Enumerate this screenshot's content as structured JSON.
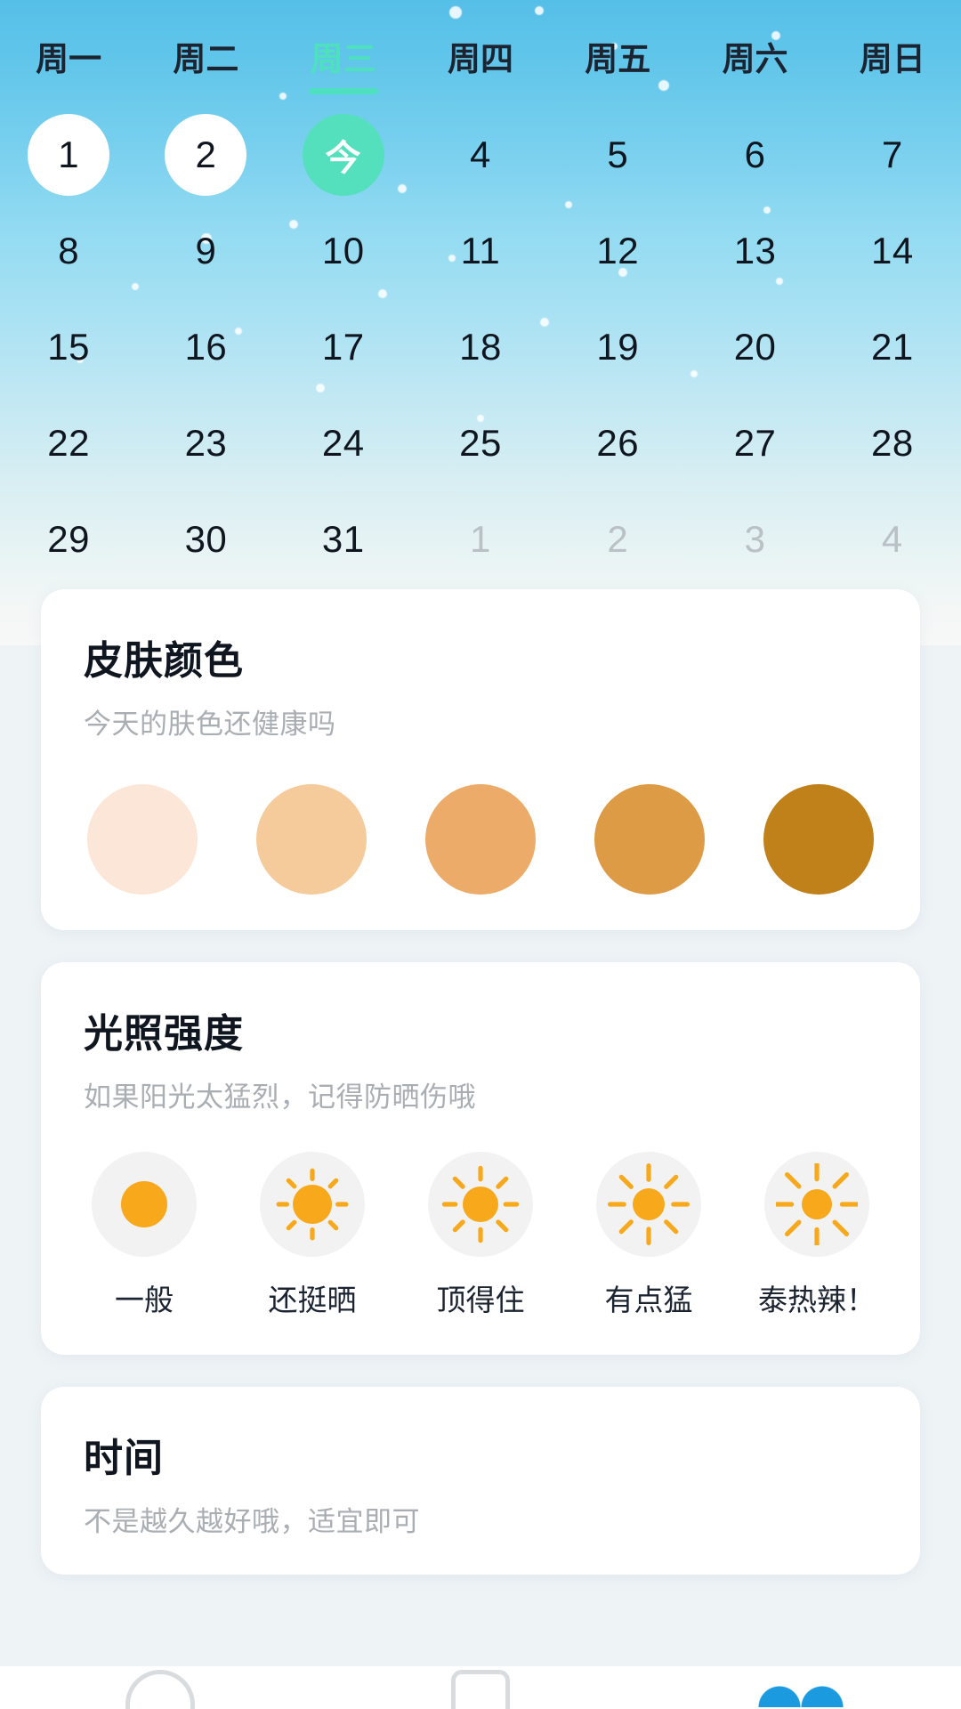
{
  "calendar": {
    "weekdays": [
      {
        "label": "周一",
        "active": false
      },
      {
        "label": "周二",
        "active": false
      },
      {
        "label": "周三",
        "active": true
      },
      {
        "label": "周四",
        "active": false
      },
      {
        "label": "周五",
        "active": false
      },
      {
        "label": "周六",
        "active": false
      },
      {
        "label": "周日",
        "active": false
      }
    ],
    "days": [
      {
        "label": "1",
        "state": "marked"
      },
      {
        "label": "2",
        "state": "marked"
      },
      {
        "label": "今",
        "state": "today"
      },
      {
        "label": "4",
        "state": "normal"
      },
      {
        "label": "5",
        "state": "normal"
      },
      {
        "label": "6",
        "state": "normal"
      },
      {
        "label": "7",
        "state": "normal"
      },
      {
        "label": "8",
        "state": "normal"
      },
      {
        "label": "9",
        "state": "normal"
      },
      {
        "label": "10",
        "state": "normal"
      },
      {
        "label": "11",
        "state": "normal"
      },
      {
        "label": "12",
        "state": "normal"
      },
      {
        "label": "13",
        "state": "normal"
      },
      {
        "label": "14",
        "state": "normal"
      },
      {
        "label": "15",
        "state": "normal"
      },
      {
        "label": "16",
        "state": "normal"
      },
      {
        "label": "17",
        "state": "normal"
      },
      {
        "label": "18",
        "state": "normal"
      },
      {
        "label": "19",
        "state": "normal"
      },
      {
        "label": "20",
        "state": "normal"
      },
      {
        "label": "21",
        "state": "normal"
      },
      {
        "label": "22",
        "state": "normal"
      },
      {
        "label": "23",
        "state": "normal"
      },
      {
        "label": "24",
        "state": "normal"
      },
      {
        "label": "25",
        "state": "normal"
      },
      {
        "label": "26",
        "state": "normal"
      },
      {
        "label": "27",
        "state": "normal"
      },
      {
        "label": "28",
        "state": "normal"
      },
      {
        "label": "29",
        "state": "normal"
      },
      {
        "label": "30",
        "state": "normal"
      },
      {
        "label": "31",
        "state": "normal"
      },
      {
        "label": "1",
        "state": "muted"
      },
      {
        "label": "2",
        "state": "muted"
      },
      {
        "label": "3",
        "state": "muted"
      },
      {
        "label": "4",
        "state": "muted"
      }
    ],
    "accent_color": "#4fe0c0",
    "today_bg_color": "#55e0bd"
  },
  "skin_card": {
    "title": "皮肤颜色",
    "subtitle": "今天的肤色还健康吗",
    "swatches": [
      {
        "name": "skin-tone-1",
        "color": "#fbe6d7"
      },
      {
        "name": "skin-tone-2",
        "color": "#f6cb9b"
      },
      {
        "name": "skin-tone-3",
        "color": "#edab69"
      },
      {
        "name": "skin-tone-4",
        "color": "#dd9b45"
      },
      {
        "name": "skin-tone-5",
        "color": "#c0811a"
      }
    ]
  },
  "light_card": {
    "title": "光照强度",
    "subtitle": "如果阳光太猛烈，记得防晒伤哦",
    "sun_color": "#f7a81b",
    "disc_color": "#f2f2f2",
    "options": [
      {
        "label": "一般",
        "icon": "sun-icon-level-1",
        "rays": 0,
        "core": 26
      },
      {
        "label": "还挺晒",
        "icon": "sun-icon-level-2",
        "rays": 8,
        "core": 22
      },
      {
        "label": "顶得住",
        "icon": "sun-icon-level-3",
        "rays": 8,
        "core": 20
      },
      {
        "label": "有点猛",
        "icon": "sun-icon-level-4",
        "rays": 8,
        "core": 18
      },
      {
        "label": "泰热辣！",
        "icon": "sun-icon-level-5",
        "rays": 8,
        "core": 17
      }
    ]
  },
  "time_card": {
    "title": "时间",
    "subtitle": "不是越久越好哦，适宜即可"
  },
  "bottom_nav": {
    "items": [
      {
        "name": "nav-home",
        "shape": "rounded"
      },
      {
        "name": "nav-record",
        "shape": "square"
      },
      {
        "name": "nav-profile",
        "shape": "heart",
        "color": "#1b9ae0"
      }
    ]
  }
}
